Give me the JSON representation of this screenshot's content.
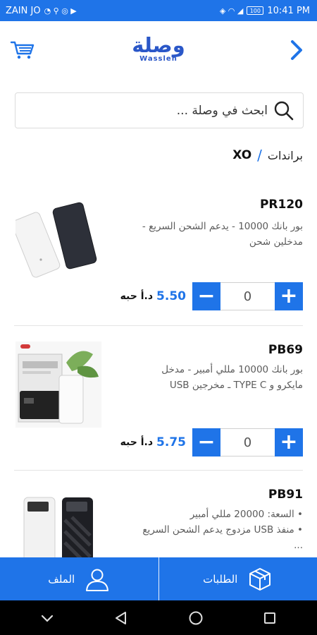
{
  "status_bar": {
    "carrier": "ZAIN JO",
    "time": "10:41 PM",
    "battery_label": "100"
  },
  "header": {
    "logo_arabic": "وصلة",
    "logo_english": "Wassleh"
  },
  "search": {
    "placeholder": "ابحث في وصلة ..."
  },
  "breadcrumb": {
    "parent": "براندات",
    "separator": "/",
    "current": "XO"
  },
  "products": [
    {
      "name": "PR120",
      "description": "بور بانك 10000 - يدعم الشحن السريع - مدخلين شحن",
      "price": "5.50",
      "unit": "د.أ حبه",
      "quantity": "0",
      "image_icon": "white-black-power-banks-image"
    },
    {
      "name": "PB69",
      "description": "بور بانك 10000 مللي أمبير - مدخل مايكرو و TYPE C ـ مخرجين USB",
      "price": "5.75",
      "unit": "د.أ حبه",
      "quantity": "0",
      "image_icon": "boxed-power-bank-image"
    },
    {
      "name": "PB91",
      "description": "• السعة: 20000 مللي أمبير\n• منفذ USB مزدوج يدعم الشحن السريع ...",
      "image_icon": "white-black-power-banks-image"
    }
  ],
  "stepper": {
    "minus": "−",
    "plus": "+"
  },
  "bottom_nav": {
    "orders_label": "الطلبات",
    "profile_label": "الملف"
  },
  "colors": {
    "primary": "#1f74e8",
    "logo": "#2a57c8"
  }
}
